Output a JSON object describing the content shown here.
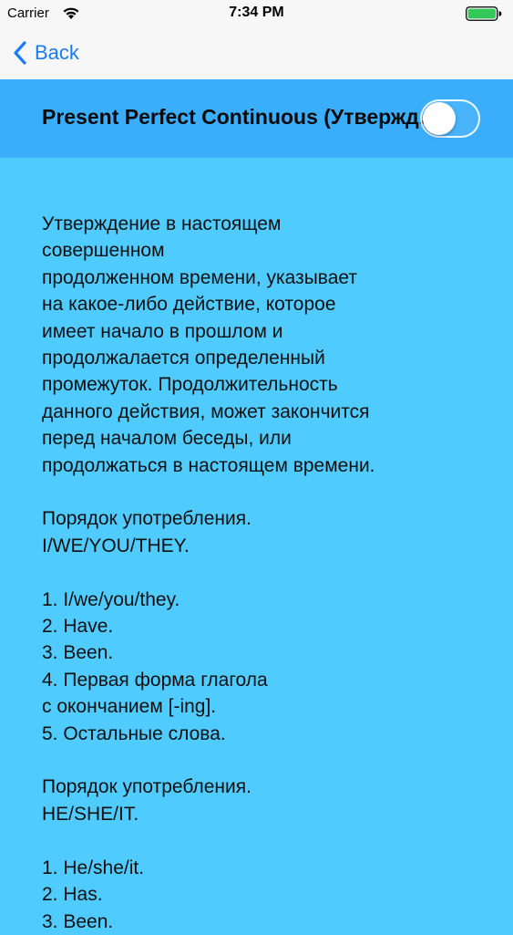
{
  "status_bar": {
    "carrier": "Carrier",
    "time": "7:34 PM",
    "wifi_icon": "wifi-icon",
    "battery_icon": "battery-full-icon"
  },
  "nav": {
    "back_label": "Back",
    "back_icon": "chevron-left-icon",
    "accent_color": "#1a7cf5"
  },
  "header": {
    "title": "Present Perfect Continuous (Утвержд...",
    "toggle_on": false,
    "background_color": "#3aaefb"
  },
  "content": {
    "background_color": "#4fcbfd",
    "intro": [
      "Утверждение в настоящем",
      "совершенном",
      "продолженном времени, указывает",
      "на какое-либо действие, которое",
      "имеет начало в прошлом и",
      "продолжалается определенный",
      "промежуток. Продолжительность",
      "данного действия, может закончится",
      "перед началом беседы, или",
      "продолжаться в настоящем времени."
    ],
    "section1_heading": [
      "Порядок употребления.",
      "I/WE/YOU/THEY."
    ],
    "section1_items": [
      "1. I/we/you/they.",
      "2. Have.",
      "3. Been.",
      "4. Первая форма глагола",
      "с окончанием [-ing].",
      "5. Остальные слова."
    ],
    "section2_heading": [
      "Порядок употребления.",
      "HE/SHE/IT."
    ],
    "section2_items": [
      "1. He/she/it.",
      "2. Has.",
      "3. Been."
    ]
  }
}
